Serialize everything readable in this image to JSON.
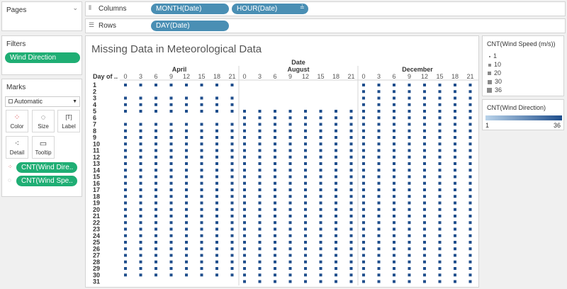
{
  "pages": {
    "title": "Pages"
  },
  "filters": {
    "title": "Filters",
    "pill": "Wind Direction"
  },
  "marks": {
    "title": "Marks",
    "type_selected": "Automatic",
    "buttons": {
      "color": "Color",
      "size": "Size",
      "label": "Label",
      "detail": "Detail",
      "tooltip": "Tooltip"
    },
    "pills": [
      "CNT(Wind Dire..",
      "CNT(Wind Spe.."
    ]
  },
  "shelves": {
    "columns_label": "Columns",
    "rows_label": "Rows",
    "columns_pills": [
      "MONTH(Date)",
      "HOUR(Date)"
    ],
    "rows_pills": [
      "DAY(Date)"
    ]
  },
  "view": {
    "title": "Missing Data in Meteorological Data",
    "date_header": "Date",
    "row_header": "Day of ..",
    "months": [
      "April",
      "August",
      "December"
    ],
    "hour_ticks": [
      "0",
      "3",
      "6",
      "9",
      "12",
      "15",
      "18",
      "21"
    ],
    "days": [
      "1",
      "2",
      "3",
      "4",
      "5",
      "6",
      "7",
      "8",
      "9",
      "10",
      "11",
      "12",
      "13",
      "14",
      "15",
      "16",
      "17",
      "18",
      "19",
      "20",
      "21",
      "22",
      "23",
      "24",
      "25",
      "26",
      "27",
      "28",
      "29",
      "30",
      "31"
    ]
  },
  "size_legend": {
    "title": "CNT(Wind Speed (m/s))",
    "items": [
      "1",
      "10",
      "20",
      "30",
      "36"
    ]
  },
  "color_legend": {
    "title": "CNT(Wind Direction)",
    "min": "1",
    "max": "36",
    "color_min": "#b9d3ea",
    "color_max": "#1f4e8c"
  },
  "colors": {
    "mark": "#1f4e8c",
    "pill_blue": "#4a8fb4",
    "pill_green": "#1fae74"
  },
  "chart_data": {
    "type": "heatmap",
    "title": "Missing Data in Meteorological Data",
    "x_header": "Date",
    "y_header": "Day of ..",
    "facets": [
      "April",
      "August",
      "December"
    ],
    "x_ticks": [
      0,
      3,
      6,
      9,
      12,
      15,
      18,
      21
    ],
    "y": [
      "1",
      "2",
      "3",
      "4",
      "5",
      "6",
      "7",
      "8",
      "9",
      "10",
      "11",
      "12",
      "13",
      "14",
      "15",
      "16",
      "17",
      "18",
      "19",
      "20",
      "21",
      "22",
      "23",
      "24",
      "25",
      "26",
      "27",
      "28",
      "29",
      "30",
      "31"
    ],
    "present": {
      "April": [
        1,
        0,
        1,
        1,
        1,
        0,
        1,
        1,
        1,
        1,
        1,
        1,
        1,
        1,
        1,
        1,
        1,
        1,
        1,
        1,
        1,
        1,
        1,
        1,
        1,
        1,
        1,
        1,
        1,
        1,
        0
      ],
      "August": [
        0,
        0,
        0,
        0,
        1,
        1,
        1,
        1,
        1,
        1,
        1,
        1,
        1,
        1,
        1,
        1,
        1,
        1,
        1,
        1,
        1,
        1,
        1,
        1,
        1,
        1,
        1,
        1,
        1,
        1,
        1
      ],
      "December": [
        1,
        1,
        1,
        1,
        1,
        1,
        1,
        1,
        1,
        1,
        1,
        1,
        1,
        1,
        1,
        1,
        1,
        1,
        1,
        1,
        1,
        1,
        1,
        1,
        1,
        1,
        1,
        1,
        1,
        1,
        1
      ]
    }
  }
}
